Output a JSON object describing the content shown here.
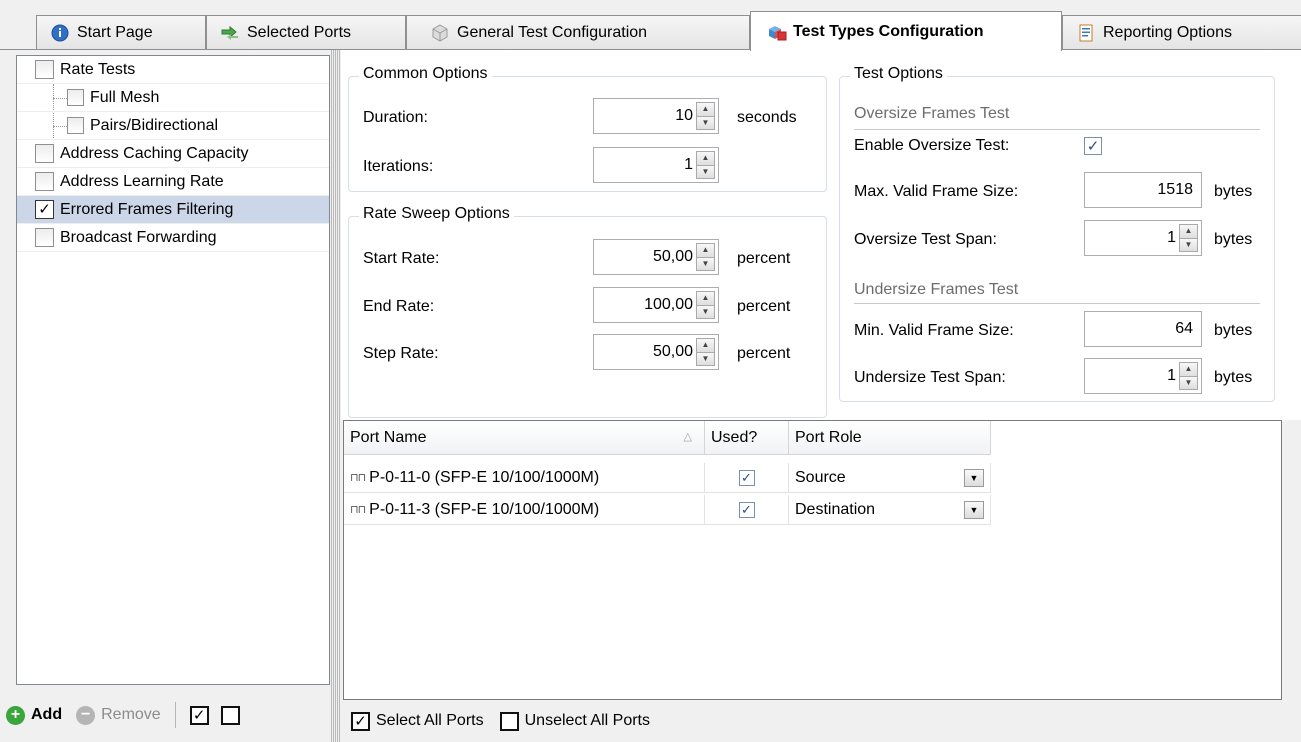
{
  "tabs": [
    {
      "label": "Start Page",
      "icon": "info-icon"
    },
    {
      "label": "Selected Ports",
      "icon": "ports-arrow-icon"
    },
    {
      "label": "General Test Configuration",
      "icon": "cube-icon"
    },
    {
      "label": "Test Types Configuration",
      "icon": "test-types-icon",
      "active": true
    },
    {
      "label": "Reporting Options",
      "icon": "report-icon"
    }
  ],
  "tree": {
    "items": [
      {
        "label": "Rate Tests",
        "checked": false
      },
      {
        "label": "Full Mesh",
        "checked": false
      },
      {
        "label": "Pairs/Bidirectional",
        "checked": false
      },
      {
        "label": "Address Caching Capacity",
        "checked": false
      },
      {
        "label": "Address Learning Rate",
        "checked": false
      },
      {
        "label": "Errored Frames Filtering",
        "checked": true
      },
      {
        "label": "Broadcast Forwarding",
        "checked": false
      }
    ]
  },
  "left_toolbar": {
    "add_label": "Add",
    "remove_label": "Remove"
  },
  "common_options": {
    "title": "Common Options",
    "duration_label": "Duration:",
    "duration_value": "10",
    "duration_unit": "seconds",
    "iterations_label": "Iterations:",
    "iterations_value": "1"
  },
  "rate_sweep": {
    "title": "Rate Sweep Options",
    "start_label": "Start Rate:",
    "start_value": "50,00",
    "end_label": "End Rate:",
    "end_value": "100,00",
    "step_label": "Step Rate:",
    "step_value": "50,00",
    "unit": "percent"
  },
  "test_options": {
    "title": "Test Options",
    "oversize_section": "Oversize Frames Test",
    "enable_oversize_label": "Enable Oversize Test:",
    "enable_oversize_checked": true,
    "max_frame_label": "Max. Valid Frame Size:",
    "max_frame_value": "1518",
    "oversize_span_label": "Oversize Test Span:",
    "oversize_span_value": "1",
    "undersize_section": "Undersize Frames Test",
    "min_frame_label": "Min. Valid Frame Size:",
    "min_frame_value": "64",
    "undersize_span_label": "Undersize Test Span:",
    "undersize_span_value": "1",
    "unit": "bytes"
  },
  "ports_grid": {
    "columns": [
      "Port Name",
      "Used?",
      "Port Role"
    ],
    "rows": [
      {
        "name": "P-0-11-0 (SFP-E 10/100/1000M)",
        "used": true,
        "role": "Source"
      },
      {
        "name": "P-0-11-3 (SFP-E 10/100/1000M)",
        "used": true,
        "role": "Destination"
      }
    ]
  },
  "bottom": {
    "select_all_label": "Select All Ports",
    "unselect_all_label": "Unselect All Ports"
  },
  "colors": {
    "selection": "#cbd6e8",
    "add_green": "#3aa53a",
    "remove_grey": "#b5b5b5"
  }
}
